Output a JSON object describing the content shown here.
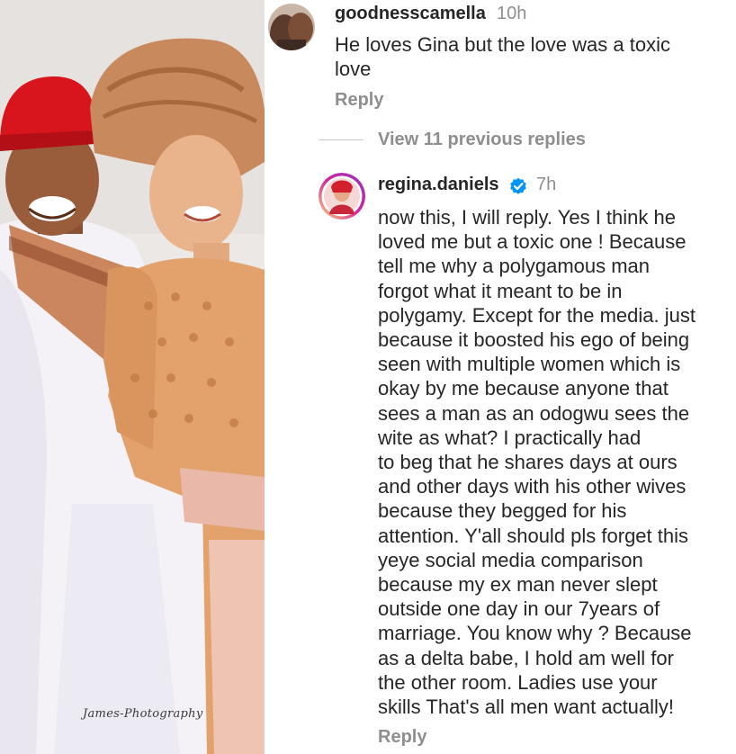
{
  "photo": {
    "watermark": "James-Photography"
  },
  "comments": [
    {
      "username": "goodnesscamella",
      "time": "10h",
      "lines": [
        "He loves Gina but the love was a toxic",
        "love"
      ],
      "reply_label": "Reply"
    },
    {
      "username": "regina.daniels",
      "verified": true,
      "time": "7h",
      "lines": [
        "now this, I will reply. Yes I think he",
        "loved me but a toxic one ! Because",
        "tell me why a polygamous man",
        "forgot what it meant to be in",
        "polygamy. Except for the media. just",
        "because it boosted his ego of being",
        "seen with multiple women which is",
        "okay by me because anyone that",
        "sees a man as an odogwu sees the",
        "wite as what? I practically had",
        "to beg that he shares days at ours",
        "and other days with his other wives",
        "because they begged for his",
        "attention. Y'all should pls forget this",
        "yeye social media comparison",
        "because my ex man never slept",
        "outside one day in our 7years of",
        "marriage. You know why ? Because",
        "as a delta babe, I hold am well for",
        "the other room. Ladies use your",
        "skills That's all men want actually!"
      ],
      "reply_label": "Reply"
    }
  ],
  "view_replies_label": "View 11 previous replies",
  "colors": {
    "text": "#262626",
    "muted": "#8e8e8e",
    "verified_badge": "#0095f6",
    "story_ring": "#d6249f"
  }
}
